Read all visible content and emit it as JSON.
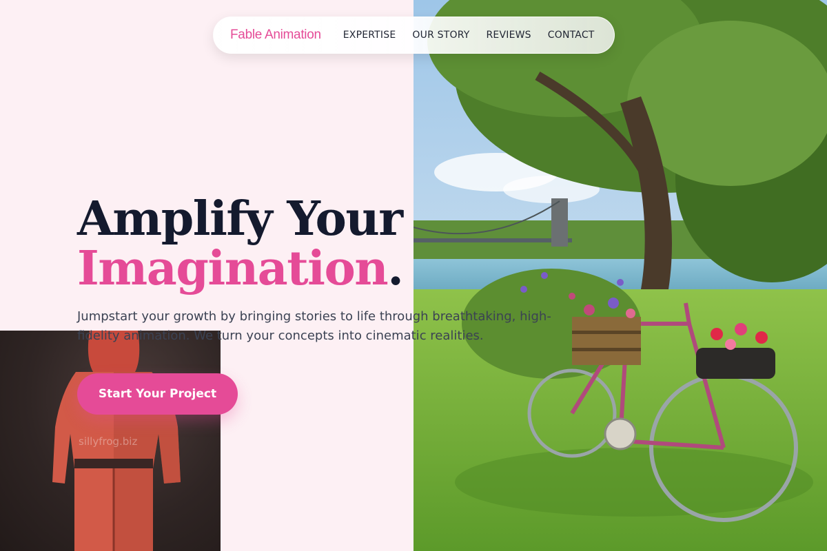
{
  "nav": {
    "brand": "Fable Animation",
    "links": [
      {
        "label": "EXPERTISE"
      },
      {
        "label": "OUR STORY"
      },
      {
        "label": "REVIEWS"
      },
      {
        "label": "CONTACT"
      }
    ]
  },
  "hero": {
    "headline_line1": "Amplify Your",
    "headline_accent": "Imagination",
    "headline_period": ".",
    "subtitle": "Jumpstart your growth by bringing stories to life through breathtaking, high-fidelity animation. We turn your concepts into cinematic realities.",
    "cta_label": "Start Your Project"
  },
  "images": {
    "hero_photo": "bicycle-with-flower-baskets-by-river-photo",
    "render_photo": "3d-character-red-jumpsuit-render",
    "render_watermark": "sillyfrog.biz"
  },
  "colors": {
    "accent": "#e54b97",
    "heading": "#141a2e",
    "body": "#3b4253",
    "background": "#fdf0f4"
  }
}
